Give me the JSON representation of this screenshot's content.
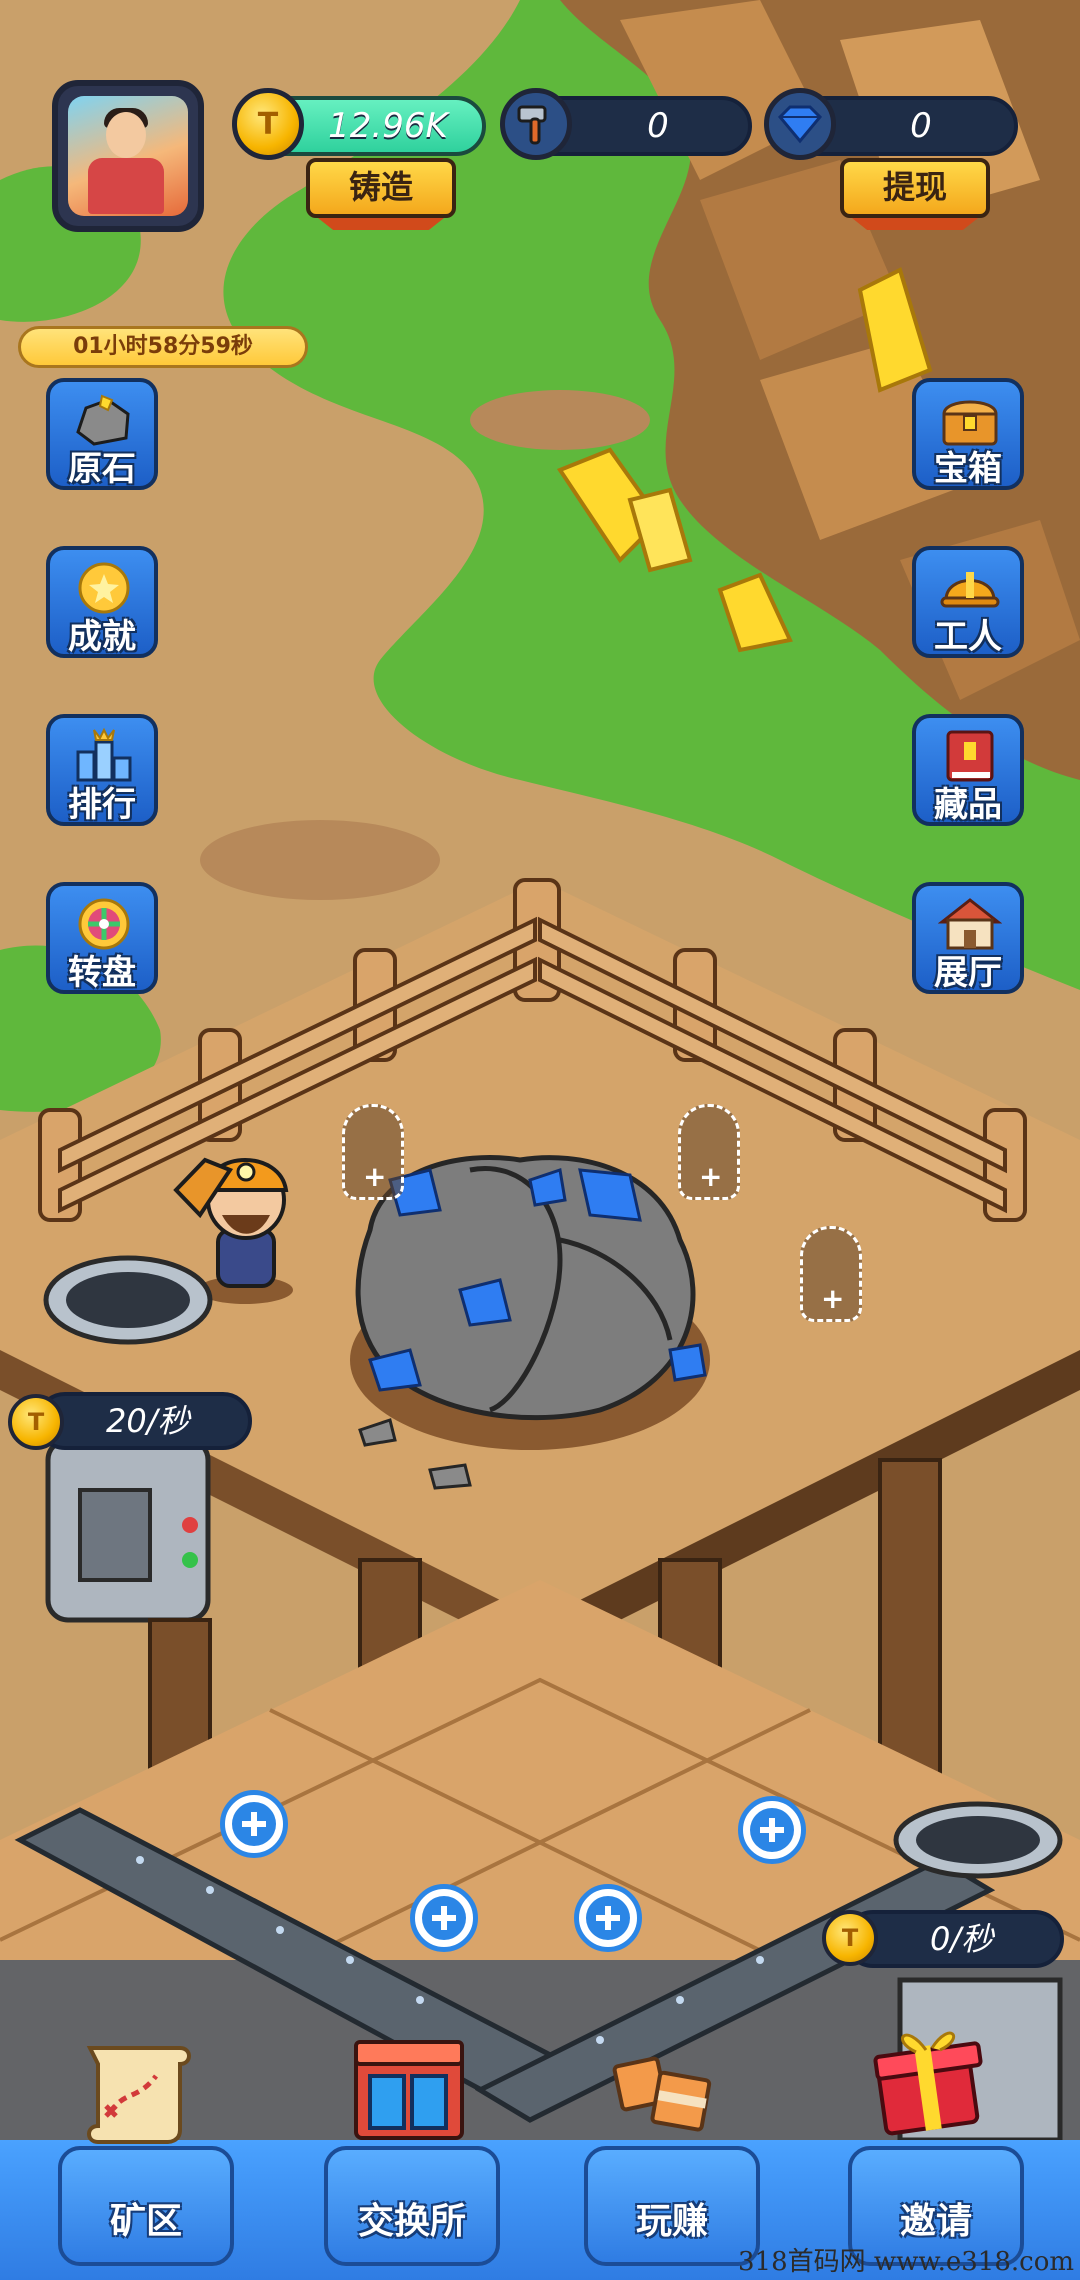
{
  "header": {
    "coins": "12.96K",
    "forge_label": "铸造",
    "hammers": "0",
    "gems": "0",
    "withdraw_label": "提现"
  },
  "timer": "01小时58分59秒",
  "left_menu": [
    {
      "label": "原石",
      "icon": "ore-stone-icon"
    },
    {
      "label": "成就",
      "icon": "achievement-medal-icon"
    },
    {
      "label": "排行",
      "icon": "ranking-crown-icon"
    },
    {
      "label": "转盘",
      "icon": "lucky-wheel-icon"
    }
  ],
  "right_menu": [
    {
      "label": "宝箱",
      "icon": "treasure-chest-icon"
    },
    {
      "label": "工人",
      "icon": "hard-hat-icon"
    },
    {
      "label": "藏品",
      "icon": "collection-book-icon"
    },
    {
      "label": "展厅",
      "icon": "house-icon"
    }
  ],
  "mine_rate": "20/秒",
  "conveyor_rate": "0/秒",
  "bottom_nav": [
    {
      "label": "矿区",
      "icon": "map-scroll-icon"
    },
    {
      "label": "交换所",
      "icon": "shop-icon"
    },
    {
      "label": "玩赚",
      "icon": "gift-box-icon"
    },
    {
      "label": "邀请",
      "icon": "red-gift-icon"
    }
  ],
  "watermark": "318首码网 www.e318.com",
  "colors": {
    "accent": "#2f7ce3",
    "gold": "#f7b500",
    "panel": "#1e2d47",
    "grass": "#5fb83c",
    "dirt": "#c79a62"
  }
}
